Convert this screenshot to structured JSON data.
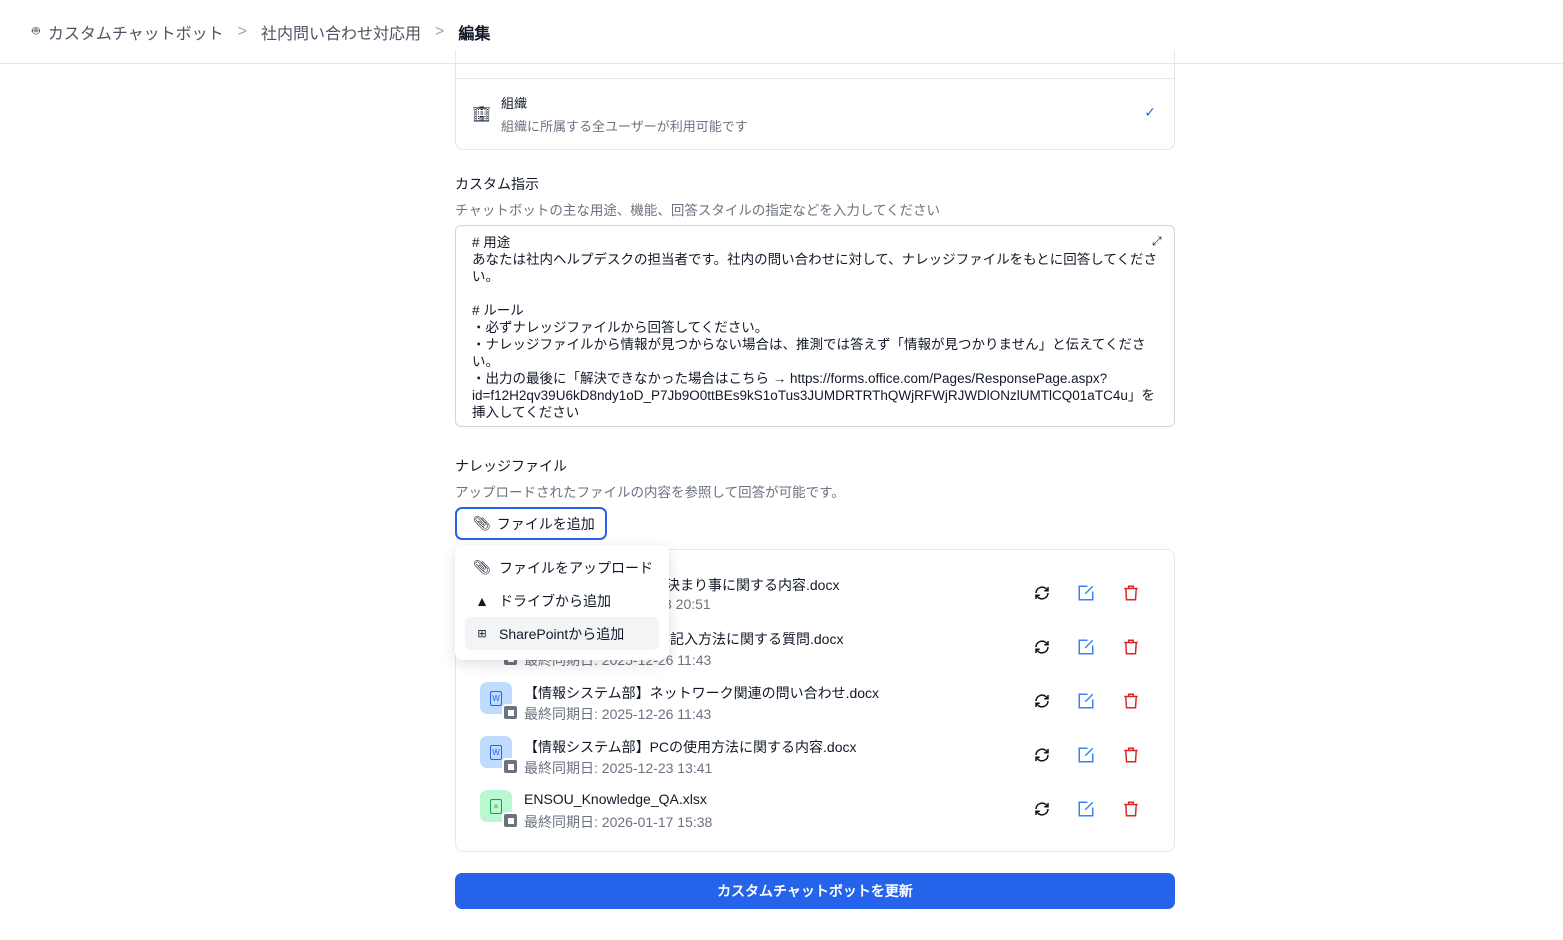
{
  "breadcrumb": {
    "items": [
      "カスタムチャットボット",
      "社内問い合わせ対応用",
      "編集"
    ]
  },
  "visibility": {
    "title": "組織",
    "description": "組織に所属する全ユーザーが利用可能です"
  },
  "custom_instructions": {
    "label": "カスタム指示",
    "description": "チャットボットの主な用途、機能、回答スタイルの指定などを入力してください",
    "value": "# 用途\nあなたは社内ヘルプデスクの担当者です。社内の問い合わせに対して、ナレッジファイルをもとに回答してください。\n\n# ルール\n・必ずナレッジファイルから回答してください。\n・ナレッジファイルから情報が見つからない場合は、推測では答えず「情報が見つかりません」と伝えてください。\n・出力の最後に「解決できなかった場合はこちら → https://forms.office.com/Pages/ResponsePage.aspx?id=f12H2qv39U6kD8ndy1oD_P7Jb9O0ttBEs9kS1oTus3JUMDRTRThQWjRFWjRJWDlONzlUMTlCQ01aTC4u」を挿入してください"
  },
  "knowledge": {
    "label": "ナレッジファイル",
    "description": "アップロードされたファイルの内容を参照して回答が可能です。",
    "add_button": "ファイルを追加",
    "menu": [
      "ファイルをアップロード",
      "ドライブから追加",
      "SharePointから追加"
    ],
    "files": [
      {
        "name": "決まり事に関する内容.docx",
        "date": "3 20:51",
        "type": "word"
      },
      {
        "name": "記入方法に関する質問.docx",
        "date": "最終同期日: 2025-12-26 11:43",
        "type": "word"
      },
      {
        "name": "【情報システム部】ネットワーク関連の問い合わせ.docx",
        "date": "最終同期日: 2025-12-26 11:43",
        "type": "word"
      },
      {
        "name": "【情報システム部】PCの使用方法に関する内容.docx",
        "date": "最終同期日: 2025-12-23 13:41",
        "type": "word"
      },
      {
        "name": "ENSOU_Knowledge_QA.xlsx",
        "date": "最終同期日: 2026-01-17 15:38",
        "type": "excel"
      }
    ]
  },
  "update_button": "カスタムチャットボットを更新",
  "colors": {
    "accent": "#2563eb",
    "danger": "#dc2626"
  }
}
